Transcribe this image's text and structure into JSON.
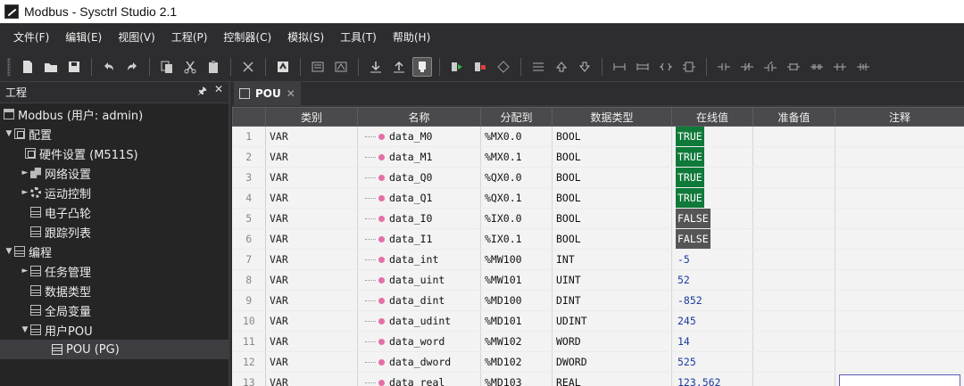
{
  "window": {
    "title": "Modbus - Sysctrl Studio 2.1"
  },
  "menu": [
    "文件(F)",
    "编辑(E)",
    "视图(V)",
    "工程(P)",
    "控制器(C)",
    "模拟(S)",
    "工具(T)",
    "帮助(H)"
  ],
  "project_panel": {
    "title": "工程",
    "pin": "ᅵ",
    "close": "✕",
    "tree": [
      {
        "label": "Modbus (用户: admin)",
        "caret": "",
        "icon": "project-icon"
      },
      {
        "label": "配置",
        "caret": "▼",
        "icon": "config-icon"
      },
      {
        "label": "硬件设置 (M511S)",
        "caret": "",
        "icon": "config-icon"
      },
      {
        "label": "网络设置",
        "caret": "►",
        "icon": "network-icon"
      },
      {
        "label": "运动控制",
        "caret": "►",
        "icon": "gear-icon"
      },
      {
        "label": "电子凸轮",
        "caret": "",
        "icon": "doc-icon"
      },
      {
        "label": "跟踪列表",
        "caret": "",
        "icon": "doc-icon"
      },
      {
        "label": "编程",
        "caret": "▼",
        "icon": "doc-icon"
      },
      {
        "label": "任务管理",
        "caret": "►",
        "icon": "doc-icon"
      },
      {
        "label": "数据类型",
        "caret": "",
        "icon": "doc-icon"
      },
      {
        "label": "全局变量",
        "caret": "",
        "icon": "doc-icon"
      },
      {
        "label": "用户POU",
        "caret": "▼",
        "icon": "doc-icon"
      },
      {
        "label": "POU (PG)",
        "caret": "",
        "icon": "pg-icon"
      }
    ]
  },
  "editor": {
    "tab_label": "POU",
    "tab_close": "✕",
    "columns": [
      "",
      "类别",
      "名称",
      "分配到",
      "数据类型",
      "在线值",
      "准备值",
      "注释"
    ],
    "rows": [
      {
        "idx": "1",
        "cat": "VAR",
        "name": "data_M0",
        "addr": "%MX0.0",
        "type": "BOOL",
        "online": "TRUE",
        "state": "true"
      },
      {
        "idx": "2",
        "cat": "VAR",
        "name": "data_M1",
        "addr": "%MX0.1",
        "type": "BOOL",
        "online": "TRUE",
        "state": "true"
      },
      {
        "idx": "3",
        "cat": "VAR",
        "name": "data_Q0",
        "addr": "%QX0.0",
        "type": "BOOL",
        "online": "TRUE",
        "state": "true"
      },
      {
        "idx": "4",
        "cat": "VAR",
        "name": "data_Q1",
        "addr": "%QX0.1",
        "type": "BOOL",
        "online": "TRUE",
        "state": "true"
      },
      {
        "idx": "5",
        "cat": "VAR",
        "name": "data_I0",
        "addr": "%IX0.0",
        "type": "BOOL",
        "online": "FALSE",
        "state": "false"
      },
      {
        "idx": "6",
        "cat": "VAR",
        "name": "data_I1",
        "addr": "%IX0.1",
        "type": "BOOL",
        "online": "FALSE",
        "state": "false"
      },
      {
        "idx": "7",
        "cat": "VAR",
        "name": "data_int",
        "addr": "%MW100",
        "type": "INT",
        "online": "-5",
        "state": "num"
      },
      {
        "idx": "8",
        "cat": "VAR",
        "name": "data_uint",
        "addr": "%MW101",
        "type": "UINT",
        "online": "52",
        "state": "num"
      },
      {
        "idx": "9",
        "cat": "VAR",
        "name": "data_dint",
        "addr": "%MD100",
        "type": "DINT",
        "online": "-852",
        "state": "num"
      },
      {
        "idx": "10",
        "cat": "VAR",
        "name": "data_udint",
        "addr": "%MD101",
        "type": "UDINT",
        "online": "245",
        "state": "num"
      },
      {
        "idx": "11",
        "cat": "VAR",
        "name": "data_word",
        "addr": "%MW102",
        "type": "WORD",
        "online": "14",
        "state": "num"
      },
      {
        "idx": "12",
        "cat": "VAR",
        "name": "data_dword",
        "addr": "%MD102",
        "type": "DWORD",
        "online": "525",
        "state": "num"
      },
      {
        "idx": "13",
        "cat": "VAR",
        "name": "data_real",
        "addr": "%MD103",
        "type": "REAL",
        "online": "123.562",
        "state": "num"
      }
    ]
  },
  "colors": {
    "true_bg": "#0f7a3a",
    "false_bg": "#555555",
    "num_fg": "#1a3c9c",
    "var_dot": "#e46fa7"
  }
}
